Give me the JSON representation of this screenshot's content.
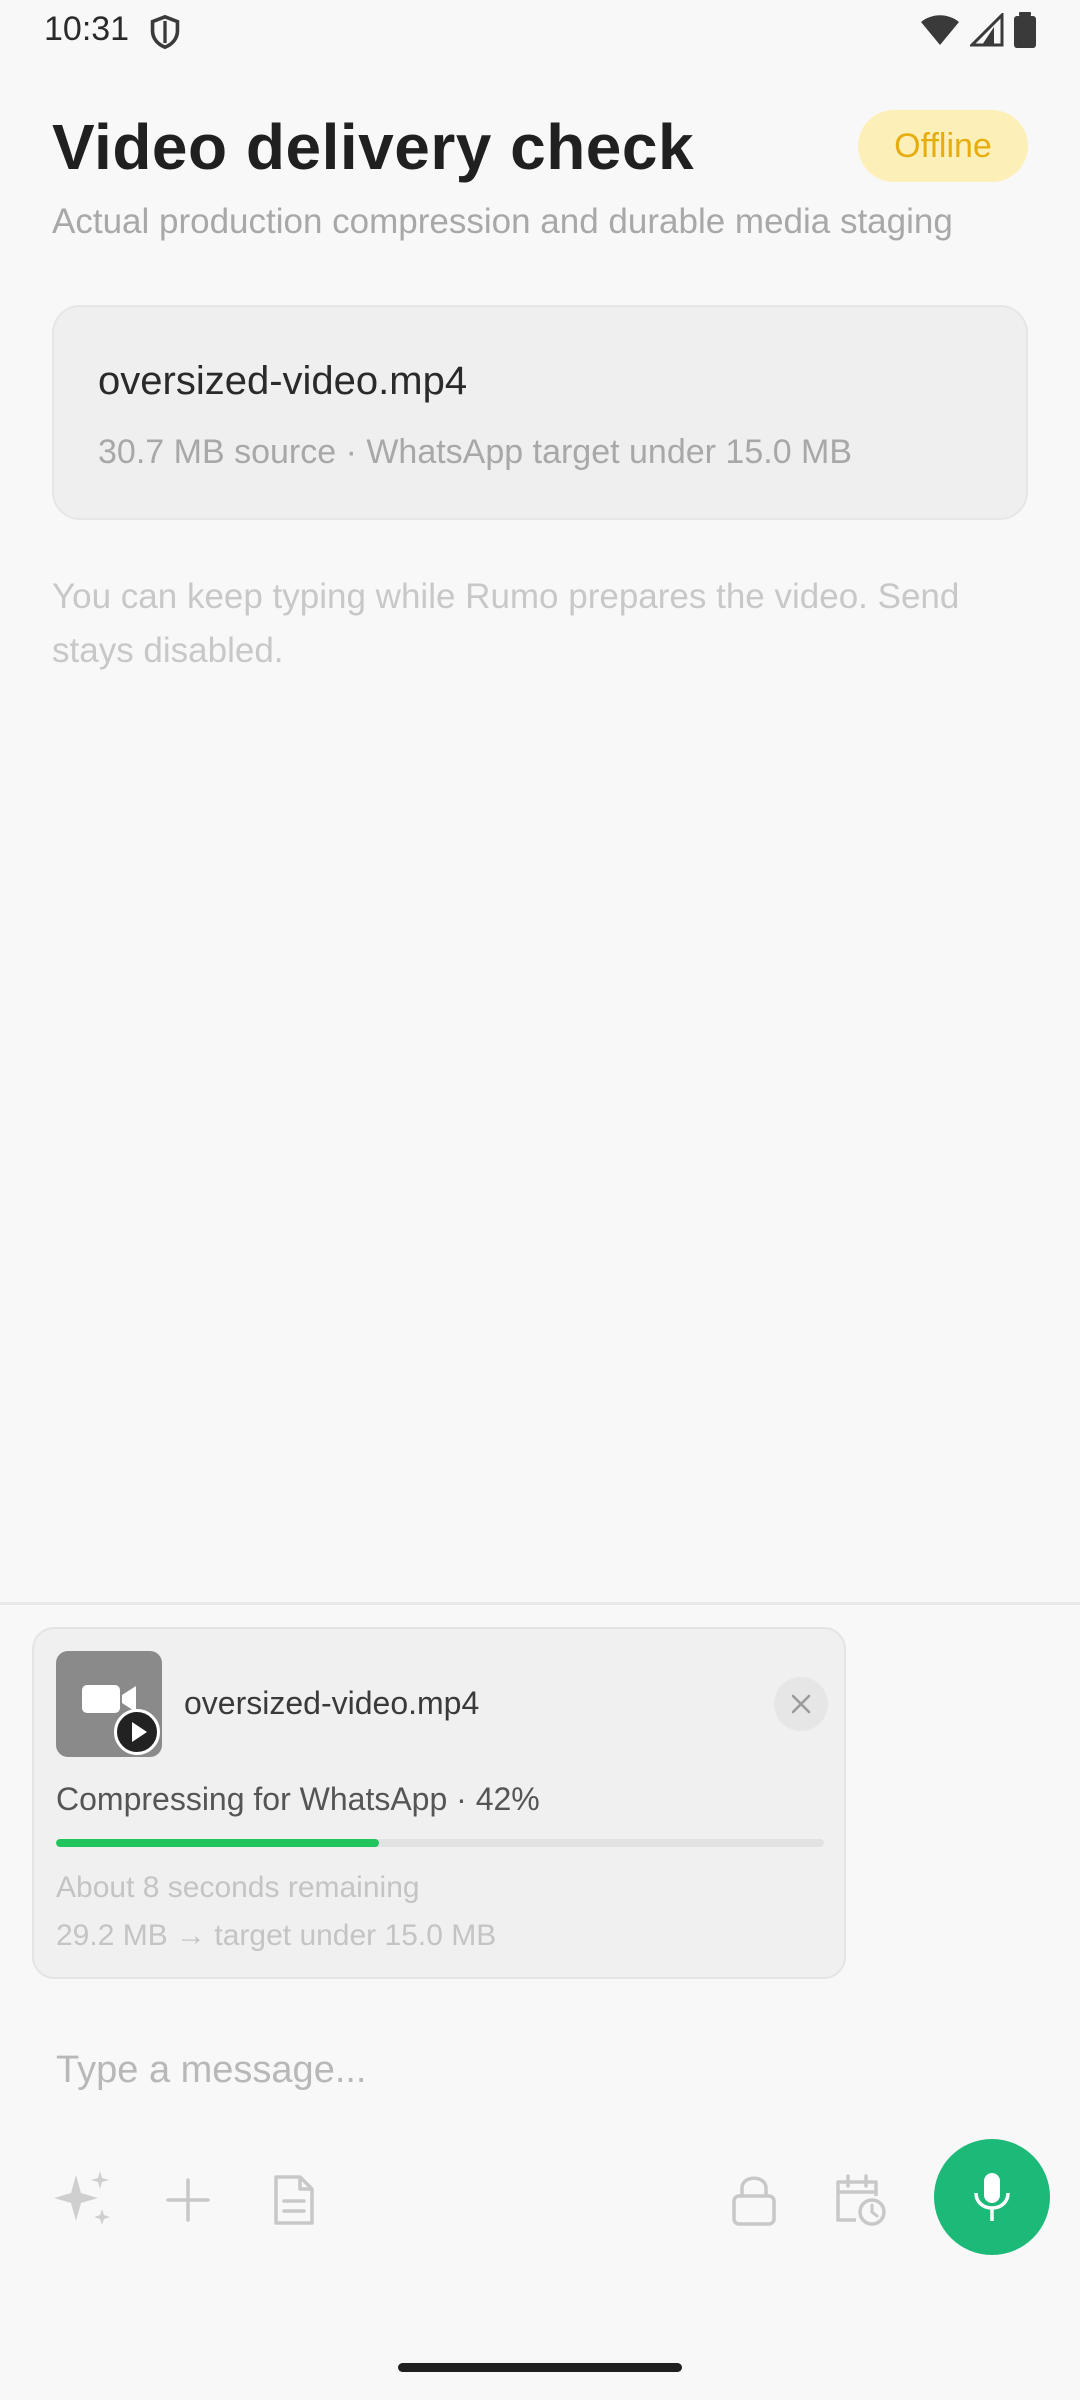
{
  "status_bar": {
    "time": "10:31"
  },
  "header": {
    "title": "Video delivery check",
    "badge": "Offline",
    "subtitle": "Actual production compression and durable media staging"
  },
  "file_card": {
    "name": "oversized-video.mp4",
    "meta": "30.7 MB source · WhatsApp target under 15.0 MB"
  },
  "hint": "You can keep typing while Rumo prepares the video. Send stays disabled.",
  "attachment": {
    "name": "oversized-video.mp4",
    "status": "Compressing for WhatsApp · 42%",
    "progress": 0.42,
    "remaining": "About 8 seconds remaining",
    "size": "29.2 MB → target under 15.0 MB"
  },
  "composer": {
    "placeholder": "Type a message..."
  },
  "toolbar": {
    "icons": [
      "sparkles-icon",
      "plus-icon",
      "document-icon",
      "lock-icon",
      "calendar-clock-icon",
      "microphone-icon"
    ]
  },
  "colors": {
    "accent": "#1db978",
    "progress": "#22c45e",
    "badge_bg": "#fdefb8",
    "badge_text": "#e6ad10"
  }
}
